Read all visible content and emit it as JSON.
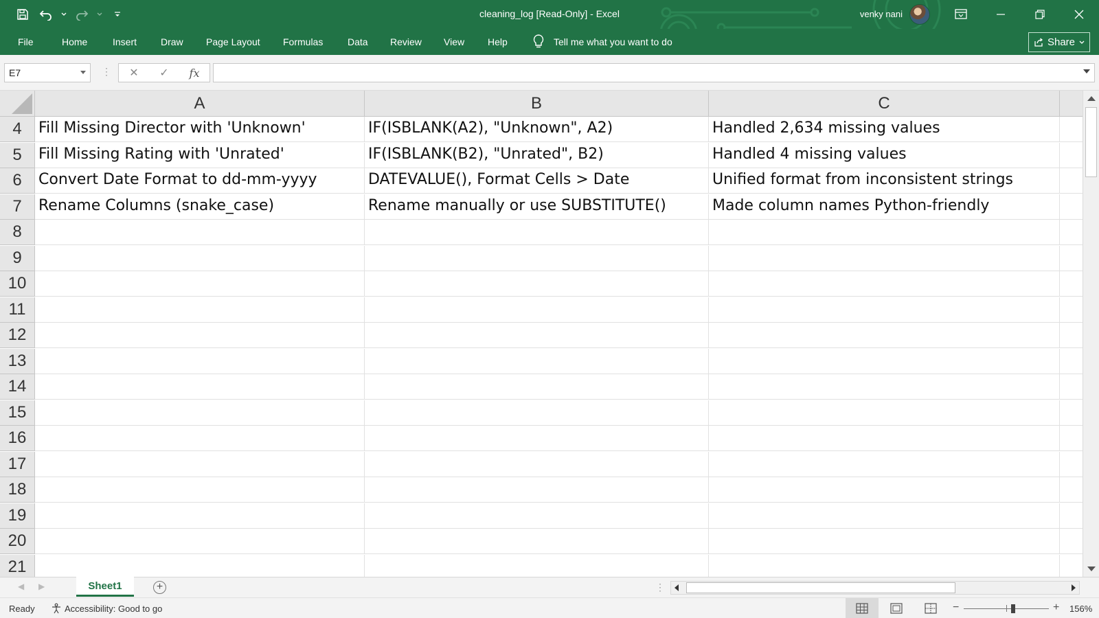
{
  "titlebar": {
    "title": "cleaning_log  [Read-Only]  -  Excel",
    "user_name": "venky nani",
    "icons": {
      "save": "save-icon",
      "undo": "undo-icon",
      "redo": "redo-icon",
      "customize": "customize-qat-icon",
      "ribbon_display": "ribbon-display-options-icon",
      "minimize": "minimize-icon",
      "restore": "restore-icon",
      "close": "close-icon"
    }
  },
  "ribbon": {
    "tabs": [
      "File",
      "Home",
      "Insert",
      "Draw",
      "Page Layout",
      "Formulas",
      "Data",
      "Review",
      "View",
      "Help"
    ],
    "tell_me": "Tell me what you want to do",
    "share_label": "Share"
  },
  "formula_bar": {
    "name_box": "E7",
    "formula": "",
    "fx_label": "fx"
  },
  "grid": {
    "columns": [
      "A",
      "B",
      "C"
    ],
    "rows": [
      {
        "num": "4",
        "cells": [
          "Fill Missing Director with 'Unknown'",
          "IF(ISBLANK(A2), \"Unknown\", A2)",
          "Handled 2,634 missing values"
        ]
      },
      {
        "num": "5",
        "cells": [
          "Fill Missing Rating with 'Unrated'",
          "IF(ISBLANK(B2), \"Unrated\", B2)",
          "Handled 4 missing values"
        ]
      },
      {
        "num": "6",
        "cells": [
          "Convert Date Format to dd-mm-yyyy",
          "DATEVALUE(), Format Cells > Date",
          "Unified format from inconsistent strings"
        ]
      },
      {
        "num": "7",
        "cells": [
          "Rename Columns (snake_case)",
          "Rename manually or use SUBSTITUTE()",
          "Made column names Python-friendly"
        ]
      },
      {
        "num": "8",
        "cells": [
          "",
          "",
          ""
        ]
      },
      {
        "num": "9",
        "cells": [
          "",
          "",
          ""
        ]
      },
      {
        "num": "10",
        "cells": [
          "",
          "",
          ""
        ]
      },
      {
        "num": "11",
        "cells": [
          "",
          "",
          ""
        ]
      },
      {
        "num": "12",
        "cells": [
          "",
          "",
          ""
        ]
      },
      {
        "num": "13",
        "cells": [
          "",
          "",
          ""
        ]
      },
      {
        "num": "14",
        "cells": [
          "",
          "",
          ""
        ]
      },
      {
        "num": "15",
        "cells": [
          "",
          "",
          ""
        ]
      },
      {
        "num": "16",
        "cells": [
          "",
          "",
          ""
        ]
      },
      {
        "num": "17",
        "cells": [
          "",
          "",
          ""
        ]
      },
      {
        "num": "18",
        "cells": [
          "",
          "",
          ""
        ]
      },
      {
        "num": "19",
        "cells": [
          "",
          "",
          ""
        ]
      },
      {
        "num": "20",
        "cells": [
          "",
          "",
          ""
        ]
      },
      {
        "num": "21",
        "cells": [
          "",
          "",
          ""
        ]
      }
    ]
  },
  "sheets": {
    "tabs": [
      "Sheet1"
    ],
    "active": "Sheet1"
  },
  "statusbar": {
    "ready": "Ready",
    "accessibility": "Accessibility: Good to go",
    "zoom": "156%"
  },
  "colors": {
    "excel_green": "#217346",
    "grid_line": "#e1e1e1",
    "header_bg": "#e6e6e6"
  }
}
